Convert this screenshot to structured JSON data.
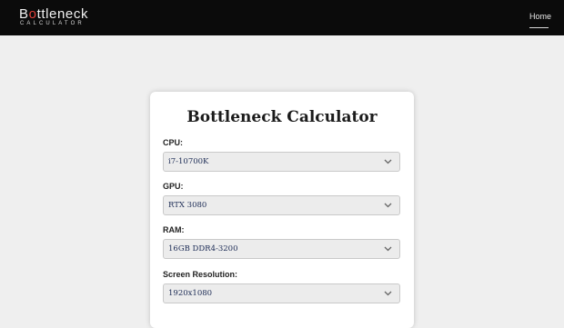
{
  "header": {
    "logo": {
      "prefix": "B",
      "accent": "o",
      "rest": "ttleneck",
      "subtitle": "CALCULATOR"
    },
    "nav": {
      "home_label": "Home"
    }
  },
  "calculator": {
    "title": "Bottleneck Calculator",
    "fields": [
      {
        "label": "CPU:",
        "value": "i7-10700K"
      },
      {
        "label": "GPU:",
        "value": "RTX 3080"
      },
      {
        "label": "RAM:",
        "value": "16GB DDR4-3200"
      },
      {
        "label": "Screen Resolution:",
        "value": "1920x1080"
      }
    ]
  },
  "colors": {
    "navbar_bg": "#0b0b0b",
    "page_bg": "#efefef",
    "logo_accent": "#e0413a",
    "select_text": "#1c2b55"
  },
  "icons": {
    "select_arrow": "chevron-down-icon"
  }
}
